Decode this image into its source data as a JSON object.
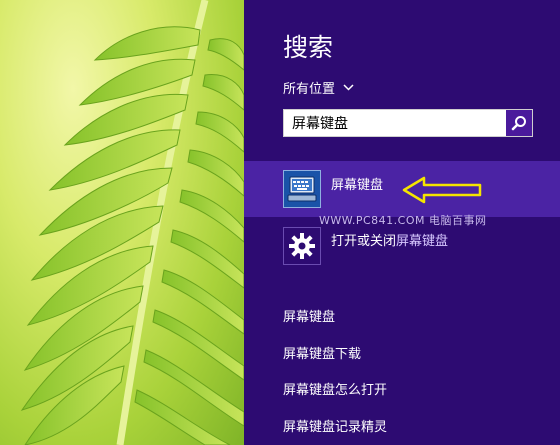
{
  "search_pane": {
    "title": "搜索",
    "scope_label": "所有位置",
    "query": "屏幕键盘",
    "search_button_icon": "magnifier-icon"
  },
  "results": [
    {
      "label": "屏幕键盘",
      "icon": "on-screen-keyboard-icon",
      "selected": true
    },
    {
      "label_prefix": "打开或关闭",
      "label_match": "屏幕键盘",
      "icon": "gear-icon",
      "selected": false
    }
  ],
  "watermark": "WWW.PC841.COM 电脑百事网",
  "suggestions": [
    {
      "match": "屏幕键盘",
      "rest": ""
    },
    {
      "match": "屏幕键盘",
      "rest": "下载"
    },
    {
      "match": "屏幕键盘",
      "rest": "怎么打开"
    },
    {
      "match": "屏幕键盘",
      "rest": "记录精灵"
    }
  ],
  "colors": {
    "pane_background": "#2d0b72",
    "selected_row": "#4b23a4",
    "annotation_arrow": "#f5e400"
  }
}
